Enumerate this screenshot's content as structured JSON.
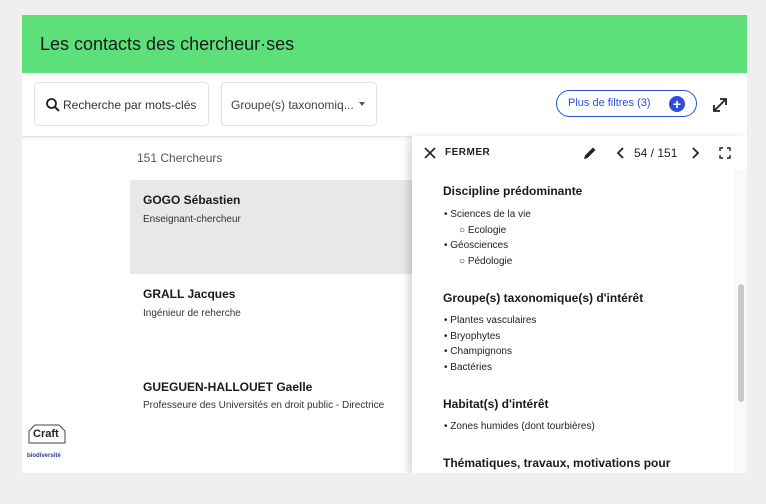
{
  "header": {
    "title": "Les contacts des chercheur·ses"
  },
  "filters": {
    "search_placeholder": "Recherche par mots-clés",
    "group_label": "Groupe(s) taxonomiq...",
    "more_filters_label": "Plus de filtres (3)"
  },
  "list": {
    "count": "151 Chercheurs",
    "rows": [
      {
        "name": "GOGO Sébastien",
        "role": "Enseignant-chercheur"
      },
      {
        "name": "GRALL Jacques",
        "role": "Ingénieur de reherche"
      },
      {
        "name": "GUEGUEN-HALLOUET Gaelle",
        "role": "Professeure des Universités en droit public - Directrice"
      }
    ]
  },
  "logos": {
    "craft": "Craft",
    "biodiv": "biodiversité"
  },
  "panel": {
    "close_label": "FERMER",
    "pager": "54 / 151",
    "sections": [
      {
        "title": "Discipline prédominante",
        "items": [
          "Sciences de la vie",
          "Ecologie",
          "Géosciences",
          "Pédologie"
        ]
      },
      {
        "title": "Groupe(s) taxonomique(s) d'intérêt",
        "items": [
          "Plantes vasculaires",
          "Bryophytes",
          "Champignons",
          "Bactéries"
        ]
      },
      {
        "title": "Habitat(s) d'intérêt",
        "items": [
          "Zones humides (dont tourbières)"
        ]
      },
      {
        "title": "Thématiques, travaux, motivations pour",
        "items": []
      }
    ]
  },
  "colors": {
    "header_bg": "#5de07a",
    "accent": "#2c4ed8",
    "selected_row": "#e8e8e8"
  }
}
